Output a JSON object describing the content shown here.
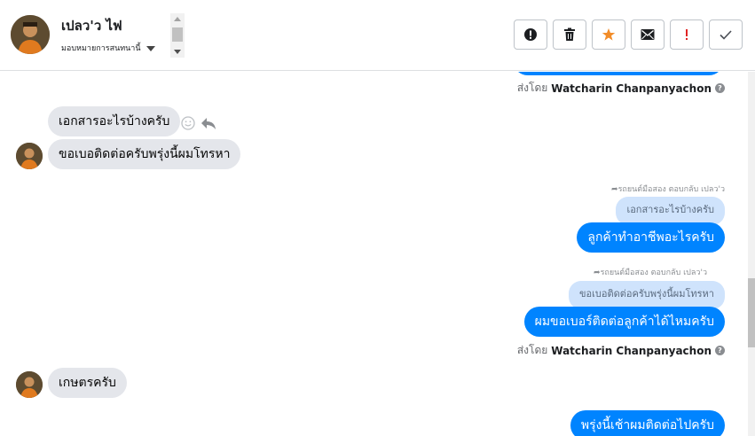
{
  "header": {
    "contact_name": "เปลว'ว ไฟ",
    "assign_label": "มอบหมายการสนทนานี้",
    "actions": [
      {
        "icon": "alert-circle-icon",
        "name": "alert-button"
      },
      {
        "icon": "trash-icon",
        "name": "delete-button"
      },
      {
        "icon": "star-icon",
        "name": "star-button"
      },
      {
        "icon": "envelope-icon",
        "name": "mail-button"
      },
      {
        "icon": "exclamation-icon",
        "name": "important-button"
      },
      {
        "icon": "check-icon",
        "name": "done-button"
      }
    ]
  },
  "chat": {
    "sent_by_prefix": "ส่งโดย",
    "sender_name": "Watcharin Chanpanyachon",
    "messages": {
      "in_1": "เอกสารอะไรบ้างครับ",
      "in_2": "ขอเบอติดต่อครับพรุ่งนี้ผมโทรหา",
      "reply_1_note": "รถยนต์มือสอง ตอบกลับ เปลว'ว",
      "reply_1_quote": "เอกสารอะไรบ้างครับ",
      "out_1": "ลูกค้าทำอาชีพอะไรครับ",
      "reply_2_note": "รถยนต์มือสอง ตอบกลับ เปลว'ว",
      "reply_2_quote": "ขอเบอติดต่อครับพรุ่งนี้ผมโทรหา",
      "out_2": "ผมขอเบอร์ติดต่อลูกค้าได้ไหมครับ",
      "in_3": "เกษตรครับ",
      "out_3": "พรุ่งนี้เช้าผมติดต่อไปครับ"
    }
  },
  "colors": {
    "outgoing": "#0084ff",
    "incoming": "#e4e6eb",
    "quote": "#cfe3fc",
    "star": "#f28c28",
    "exclamation": "#e02424"
  }
}
